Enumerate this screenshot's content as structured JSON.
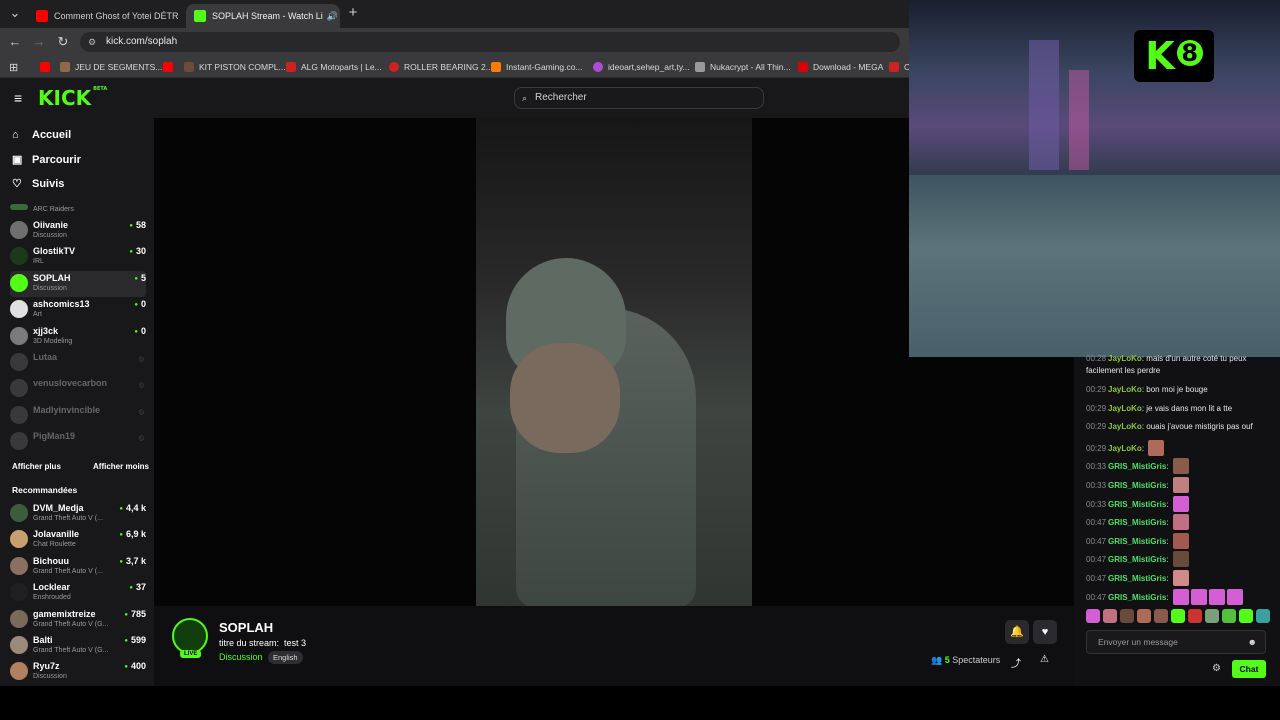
{
  "browser": {
    "tabs": [
      {
        "title": "Comment Ghost of Yotei DÉTR",
        "favicon_color": "#ff0000"
      },
      {
        "title": "SOPLAH Stream - Watch Li",
        "favicon_color": "#53fc18"
      }
    ],
    "url": "kick.com/soplah",
    "bookmarks": [
      {
        "label": "",
        "color": "#ff0000"
      },
      {
        "label": "JEU DE SEGMENTS...",
        "color": "#8b6b4b"
      },
      {
        "label": "",
        "color": "#ff0000"
      },
      {
        "label": "KIT PISTON COMPL...",
        "color": "#6b4b3b"
      },
      {
        "label": "ALG Motoparts | Le...",
        "color": "#cc2222"
      },
      {
        "label": "ROLLER BEARING 2...",
        "color": "#cc2222"
      },
      {
        "label": "Instant-Gaming.co...",
        "color": "#ff7a00"
      },
      {
        "label": "ideoart,sehep_art,ty...",
        "color": "#b04bd6"
      },
      {
        "label": "Nukacrypt - All Thin...",
        "color": "#999999"
      },
      {
        "label": "Download - MEGA",
        "color": "#d90007"
      },
      {
        "label": "C",
        "color": "#cc2222"
      }
    ]
  },
  "header": {
    "logo": "KICK",
    "logo_tag": "BETA",
    "search_placeholder": "Rechercher"
  },
  "sidebar": {
    "nav": [
      {
        "label": "Accueil",
        "icon": "home-icon"
      },
      {
        "label": "Parcourir",
        "icon": "browse-icon"
      },
      {
        "label": "Suivis",
        "icon": "heart-icon"
      }
    ],
    "partial_category": "ARC Raiders",
    "following": [
      {
        "name": "Oiivanie",
        "category": "Discussion",
        "viewers": "58",
        "avatar": "#6f6f6f"
      },
      {
        "name": "GlostikTV",
        "category": "IRL",
        "viewers": "30",
        "avatar": "#1a3a1a"
      },
      {
        "name": "SOPLAH",
        "category": "Discussion",
        "viewers": "5",
        "avatar": "#53fc18",
        "selected": true
      },
      {
        "name": "ashcomics13",
        "category": "Art",
        "viewers": "0",
        "avatar": "#e0e0e0"
      },
      {
        "name": "xjj3ck",
        "category": "3D Modeling",
        "viewers": "0",
        "avatar": "#7a7a7a"
      },
      {
        "name": "Lutaa",
        "category": "",
        "viewers": "",
        "avatar": "#777",
        "offline": true
      },
      {
        "name": "venuslovecarbon",
        "category": "",
        "viewers": "",
        "avatar": "#777",
        "offline": true
      },
      {
        "name": "Madlyinvincible",
        "category": "",
        "viewers": "",
        "avatar": "#777",
        "offline": true
      },
      {
        "name": "PigMan19",
        "category": "",
        "viewers": "",
        "avatar": "#777",
        "offline": true
      }
    ],
    "show_more": "Afficher plus",
    "show_less": "Afficher moins",
    "recommended_title": "Recommandées",
    "recommended": [
      {
        "name": "DVM_Medja",
        "category": "Grand Theft Auto V (...",
        "viewers": "4,4 k",
        "avatar": "#3b5d3b"
      },
      {
        "name": "Jolavanille",
        "category": "Chat Roulette",
        "viewers": "6,9 k",
        "avatar": "#c8a070"
      },
      {
        "name": "Bichouu",
        "category": "Grand Theft Auto V (...",
        "viewers": "3,7 k",
        "avatar": "#8a7060"
      },
      {
        "name": "Locklear",
        "category": "Enshrouded",
        "viewers": "37",
        "avatar": "#202020"
      },
      {
        "name": "gamemixtreize",
        "category": "Grand Theft Auto V (G...",
        "viewers": "785",
        "avatar": "#7a6a5a"
      },
      {
        "name": "Balti",
        "category": "Grand Theft Auto V (G...",
        "viewers": "599",
        "avatar": "#9a8a7a"
      },
      {
        "name": "Ryu7z",
        "category": "Discussion",
        "viewers": "400",
        "avatar": "#b08060"
      }
    ]
  },
  "overlay": {
    "brand": "K",
    "number": "8"
  },
  "stream": {
    "channel": "SOPLAH",
    "live_label": "LIVE",
    "title_label": "titre du stream:",
    "title": "test 3",
    "category": "Discussion",
    "language": "English",
    "viewers_count": "5",
    "viewers_label": "Spectateurs"
  },
  "chat": {
    "messages": [
      {
        "time": "00:28",
        "user": "JayLoKo",
        "text": "mais d'un autre coté tu peux facilement les perdre"
      },
      {
        "time": "00:29",
        "user": "JayLoKo",
        "text": "bon moi je bouge"
      },
      {
        "time": "00:29",
        "user": "JayLoKo",
        "text": "je vais dans mon lit a tte"
      },
      {
        "time": "00:29",
        "user": "JayLoKo",
        "text": "ouais j'avoue mistigris pas ouf"
      },
      {
        "time": "00:29",
        "user": "JayLoKo",
        "text": ""
      },
      {
        "time": "00:33",
        "user": "GRIS_MistiGris",
        "text": ""
      },
      {
        "time": "00:33",
        "user": "GRIS_MistiGris",
        "text": ""
      },
      {
        "time": "00:33",
        "user": "GRIS_MistiGris",
        "text": ""
      },
      {
        "time": "00:47",
        "user": "GRIS_MistiGris",
        "text": ""
      },
      {
        "time": "00:47",
        "user": "GRIS_MistiGris",
        "text": ""
      },
      {
        "time": "00:47",
        "user": "GRIS_MistiGris",
        "text": ""
      },
      {
        "time": "00:47",
        "user": "GRIS_MistiGris",
        "text": ""
      },
      {
        "time": "00:47",
        "user": "GRIS_MistiGris",
        "text": ""
      }
    ],
    "input_placeholder": "Envoyer un message",
    "send_label": "Chat"
  }
}
